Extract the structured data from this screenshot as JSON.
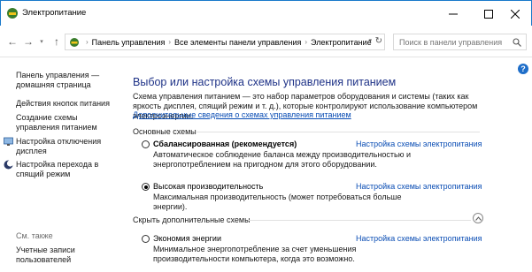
{
  "window": {
    "title": "Электропитание"
  },
  "address_bar": {
    "crumbs": [
      "Панель управления",
      "Все элементы панели управления",
      "Электропитание"
    ],
    "search_placeholder": "Поиск в панели управления"
  },
  "sidebar": {
    "home_link": "Панель управления — домашняя страница",
    "items": [
      {
        "label": "Действия кнопок питания",
        "icon": null
      },
      {
        "label": "Создание схемы управления питанием",
        "icon": null
      },
      {
        "label": "Настройка отключения дисплея",
        "icon": "monitor-icon"
      },
      {
        "label": "Настройка перехода в спящий режим",
        "icon": "moon-icon"
      }
    ],
    "see_also_title": "См. также",
    "see_also_items": [
      {
        "label": "Учетные записи пользователей"
      }
    ]
  },
  "main": {
    "title": "Выбор или настройка схемы управления питанием",
    "description": "Схема управления питанием — это набор параметров оборудования и системы (таких как яркость дисплея, спящий режим и т. д.), которые контролируют использование компьютером электроэнергии.",
    "more_link": "Дополнительные сведения о схемах управления питанием",
    "preferred_group": "Основные схемы",
    "hidden_group": "Скрыть дополнительные схемы",
    "plans": [
      {
        "name": "Сбалансированная (рекомендуется)",
        "description": "Автоматическое соблюдение баланса между производительностью и энергопотреблением на пригодном для этого оборудовании.",
        "link": "Настройка схемы электропитания",
        "selected": false
      },
      {
        "name": "Высокая производительность",
        "description": "Максимальная производительность (может потребоваться больше энергии).",
        "link": "Настройка схемы электропитания",
        "selected": true
      },
      {
        "name": "Экономия энергии",
        "description": "Минимальное энергопотребление за счет уменьшения производительности компьютера, когда это возможно.",
        "link": "Настройка схемы электропитания",
        "selected": false
      }
    ]
  },
  "colors": {
    "accent": "#1979ca",
    "title_blue": "#1e3287",
    "link_blue": "#0a4db4"
  }
}
